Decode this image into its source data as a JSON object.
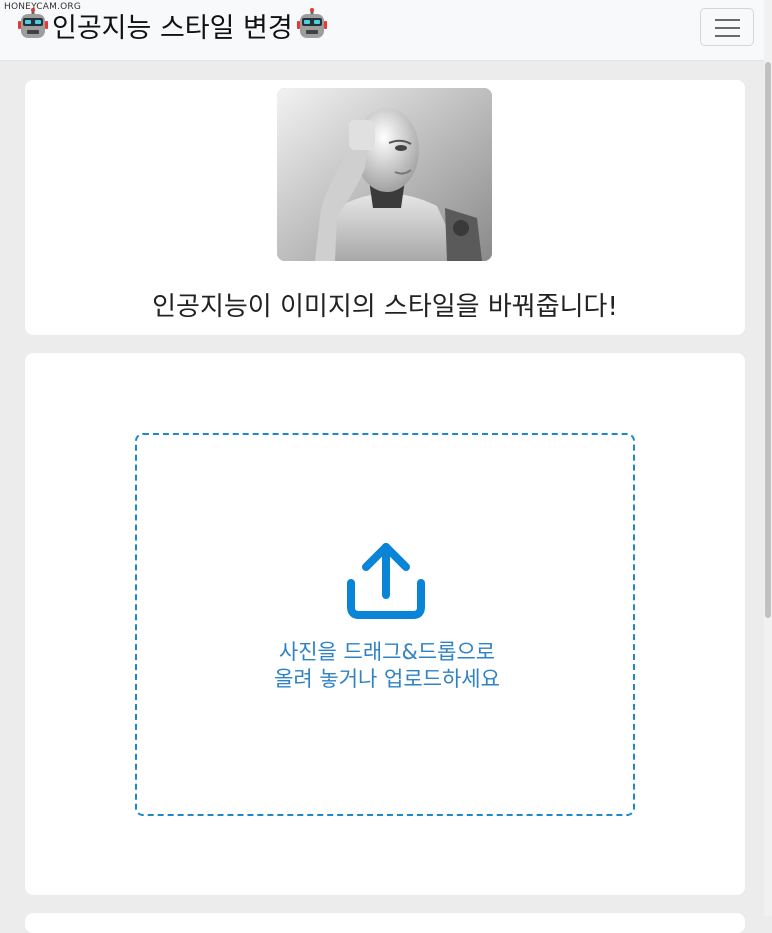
{
  "watermark": "HONEYCAM.ORG",
  "navbar": {
    "title": "인공지능 스타일 변경",
    "icon_left": "robot-icon",
    "icon_right": "robot-icon",
    "menu_icon": "hamburger-menu-icon"
  },
  "hero": {
    "image": "robot-thinking-photo",
    "tagline": "인공지능이 이미지의 스타일을 바꿔줍니다!"
  },
  "upload": {
    "icon": "upload-icon",
    "text": "사진을 드래그&드롭으로 올려 놓거나 업로드하세요",
    "accent_color": "#1e88c8"
  }
}
